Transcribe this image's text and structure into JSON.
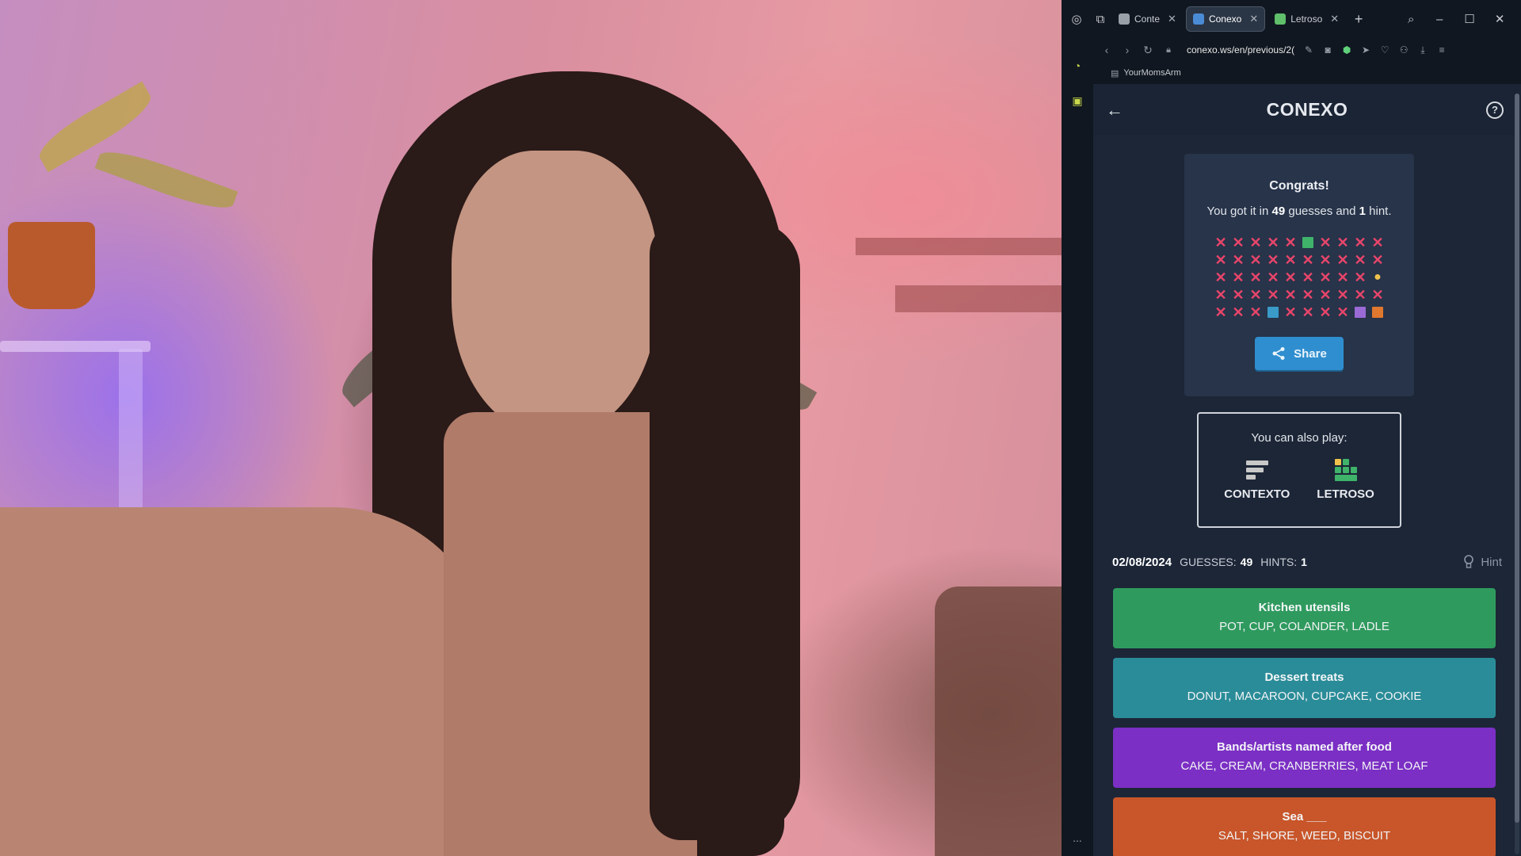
{
  "browser": {
    "tabs": [
      {
        "label": "Conte",
        "favicon_color": "#9aa0a8",
        "active": false
      },
      {
        "label": "Conexo",
        "favicon_color": "#4a8bd6",
        "active": true
      },
      {
        "label": "Letroso",
        "favicon_color": "#5fbf6a",
        "active": false
      }
    ],
    "new_tab_symbol": "+",
    "url": "conexo.ws/en/previous/2(",
    "bookmark": "YourMomsArm",
    "more_symbol": "..."
  },
  "app": {
    "title": "CONEXO",
    "back_symbol": "←",
    "help_symbol": "?",
    "result": {
      "congrats": "Congrats!",
      "text_prefix": "You got it in",
      "guesses": "49",
      "text_middle": "guesses and",
      "hints": "1",
      "text_suffix": "hint.",
      "grid": [
        [
          "x",
          "x",
          "x",
          "x",
          "x",
          "green",
          "x",
          "x",
          "x",
          "x"
        ],
        [
          "x",
          "x",
          "x",
          "x",
          "x",
          "x",
          "x",
          "x",
          "x",
          "x"
        ],
        [
          "x",
          "x",
          "x",
          "x",
          "x",
          "x",
          "x",
          "x",
          "x",
          "hint"
        ],
        [
          "x",
          "x",
          "x",
          "x",
          "x",
          "x",
          "x",
          "x",
          "x",
          "x"
        ],
        [
          "x",
          "x",
          "x",
          "blue",
          "x",
          "x",
          "x",
          "x",
          "purple",
          "orange"
        ]
      ],
      "grid_colors": {
        "x": "#e8456a",
        "green": "#3fb36a",
        "blue": "#3a9ac8",
        "purple": "#9a6ad6",
        "orange": "#e0782f",
        "hint": "#f0c24c"
      },
      "share_label": "Share"
    },
    "also_play": {
      "title": "You can also play:",
      "games": [
        "CONTEXTO",
        "LETROSO"
      ]
    },
    "stats": {
      "date": "02/08/2024",
      "guesses_label": "GUESSES:",
      "guesses_value": "49",
      "hints_label": "HINTS:",
      "hints_value": "1",
      "hint_button": "Hint"
    },
    "categories": [
      {
        "name": "Kitchen utensils",
        "words": "POT, CUP, COLANDER, LADLE",
        "color": "#2f9a5e"
      },
      {
        "name": "Dessert treats",
        "words": "DONUT, MACAROON, CUPCAKE, COOKIE",
        "color": "#2a8c98"
      },
      {
        "name": "Bands/artists named after food",
        "words": "CAKE, CREAM, CRANBERRIES, MEAT LOAF",
        "color": "#7b2fc4"
      },
      {
        "name": "Sea ___",
        "words": "SALT, SHORE, WEED, BISCUIT",
        "color": "#c8562a"
      }
    ]
  }
}
